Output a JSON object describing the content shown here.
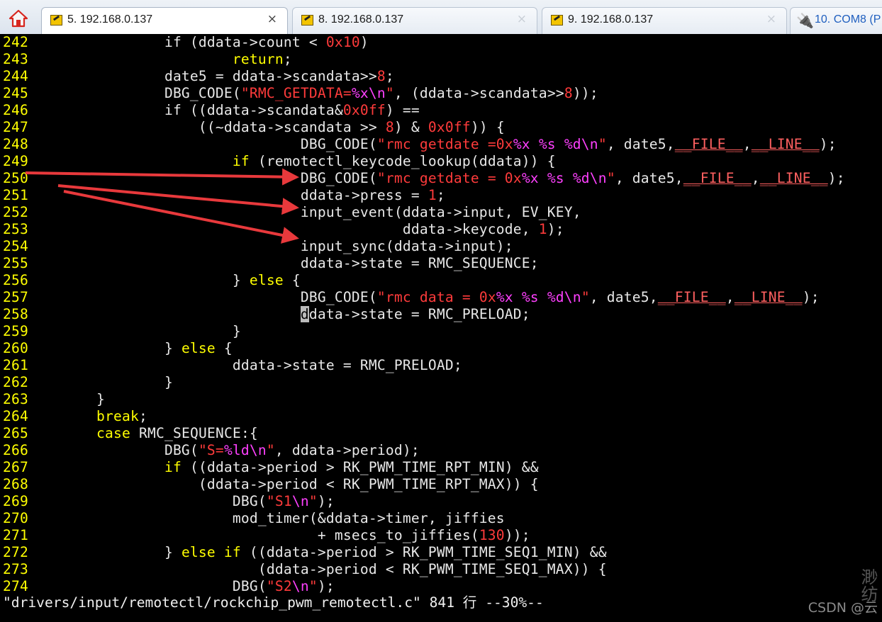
{
  "tabs": [
    {
      "label": "5. 192.168.0.137",
      "active": true,
      "close": "×"
    },
    {
      "label": "8. 192.168.0.137",
      "active": false,
      "close": "×"
    },
    {
      "label": "9. 192.168.0.137",
      "active": false,
      "close": "×"
    },
    {
      "label": "10. COM8  (P",
      "active": false
    }
  ],
  "code_lines": [
    {
      "num": "242",
      "segs": [
        [
          "t",
          "                if (ddata->count < "
        ],
        [
          "n",
          "0x10"
        ],
        [
          "t",
          ")"
        ]
      ]
    },
    {
      "num": "243",
      "segs": [
        [
          "t",
          "                        "
        ],
        [
          "k",
          "return"
        ],
        [
          "t",
          ";"
        ]
      ]
    },
    {
      "num": "244",
      "segs": [
        [
          "t",
          "                date5 = ddata->scandata>>"
        ],
        [
          "n",
          "8"
        ],
        [
          "t",
          ";"
        ]
      ]
    },
    {
      "num": "245",
      "segs": [
        [
          "t",
          "                DBG_CODE("
        ],
        [
          "s",
          "\"RMC_GETDATA="
        ],
        [
          "f",
          "%x\\n"
        ],
        [
          "s",
          "\""
        ],
        [
          "t",
          ", (ddata->scandata>>"
        ],
        [
          "n",
          "8"
        ],
        [
          "t",
          "));"
        ]
      ]
    },
    {
      "num": "246",
      "segs": [
        [
          "t",
          "                if ((ddata->scandata&"
        ],
        [
          "n",
          "0x0ff"
        ],
        [
          "t",
          ") =="
        ]
      ]
    },
    {
      "num": "247",
      "segs": [
        [
          "t",
          "                    ((~ddata->scandata >> "
        ],
        [
          "n",
          "8"
        ],
        [
          "t",
          ") & "
        ],
        [
          "n",
          "0x0ff"
        ],
        [
          "t",
          ")) {"
        ]
      ]
    },
    {
      "num": "248",
      "segs": [
        [
          "t",
          "                                DBG_CODE("
        ],
        [
          "s",
          "\"rmc getdate =0x"
        ],
        [
          "f",
          "%x"
        ],
        [
          "s",
          " "
        ],
        [
          "f",
          "%s"
        ],
        [
          "s",
          " "
        ],
        [
          "f",
          "%d\\n"
        ],
        [
          "s",
          "\""
        ],
        [
          "t",
          ", date5,"
        ],
        [
          "m",
          "__FILE__"
        ],
        [
          "t",
          ","
        ],
        [
          "m",
          "__LINE__"
        ],
        [
          "t",
          ");"
        ]
      ]
    },
    {
      "num": "249",
      "segs": [
        [
          "t",
          "                        "
        ],
        [
          "k",
          "if"
        ],
        [
          "t",
          " (remotectl_keycode_lookup(ddata)) {"
        ]
      ]
    },
    {
      "num": "250",
      "segs": [
        [
          "t",
          "                                DBG_CODE("
        ],
        [
          "s",
          "\"rmc getdate = 0x"
        ],
        [
          "f",
          "%x"
        ],
        [
          "s",
          " "
        ],
        [
          "f",
          "%s"
        ],
        [
          "s",
          " "
        ],
        [
          "f",
          "%d\\n"
        ],
        [
          "s",
          "\""
        ],
        [
          "t",
          ", date5,"
        ],
        [
          "m",
          "__FILE__"
        ],
        [
          "t",
          ","
        ],
        [
          "m",
          "__LINE__"
        ],
        [
          "t",
          ");"
        ]
      ]
    },
    {
      "num": "251",
      "segs": [
        [
          "t",
          "                                ddata->press = "
        ],
        [
          "n",
          "1"
        ],
        [
          "t",
          ";"
        ]
      ]
    },
    {
      "num": "252",
      "segs": [
        [
          "t",
          "                                input_event(ddata->input, EV_KEY,"
        ]
      ]
    },
    {
      "num": "253",
      "segs": [
        [
          "t",
          "                                            ddata->keycode, "
        ],
        [
          "n",
          "1"
        ],
        [
          "t",
          ");"
        ]
      ]
    },
    {
      "num": "254",
      "segs": [
        [
          "t",
          "                                input_sync(ddata->input);"
        ]
      ]
    },
    {
      "num": "255",
      "segs": [
        [
          "t",
          "                                ddata->state = RMC_SEQUENCE;"
        ]
      ]
    },
    {
      "num": "256",
      "segs": [
        [
          "t",
          "                        } "
        ],
        [
          "k",
          "else"
        ],
        [
          "t",
          " {"
        ]
      ]
    },
    {
      "num": "257",
      "segs": [
        [
          "t",
          "                                DBG_CODE("
        ],
        [
          "s",
          "\"rmc data = 0x"
        ],
        [
          "f",
          "%x"
        ],
        [
          "s",
          " "
        ],
        [
          "f",
          "%s"
        ],
        [
          "s",
          " "
        ],
        [
          "f",
          "%d\\n"
        ],
        [
          "s",
          "\""
        ],
        [
          "t",
          ", date5,"
        ],
        [
          "m",
          "__FILE__"
        ],
        [
          "t",
          ","
        ],
        [
          "m",
          "__LINE__"
        ],
        [
          "t",
          ");"
        ]
      ]
    },
    {
      "num": "258",
      "segs": [
        [
          "t",
          "                                "
        ],
        [
          "c",
          "d"
        ],
        [
          "t",
          "data->state = RMC_PRELOAD;"
        ]
      ]
    },
    {
      "num": "259",
      "segs": [
        [
          "t",
          "                        }"
        ]
      ]
    },
    {
      "num": "260",
      "segs": [
        [
          "t",
          "                } "
        ],
        [
          "k",
          "else"
        ],
        [
          "t",
          " {"
        ]
      ]
    },
    {
      "num": "261",
      "segs": [
        [
          "t",
          "                        ddata->state = RMC_PRELOAD;"
        ]
      ]
    },
    {
      "num": "262",
      "segs": [
        [
          "t",
          "                }"
        ]
      ]
    },
    {
      "num": "263",
      "segs": [
        [
          "t",
          "        }"
        ]
      ]
    },
    {
      "num": "264",
      "segs": [
        [
          "t",
          "        "
        ],
        [
          "k",
          "break"
        ],
        [
          "t",
          ";"
        ]
      ]
    },
    {
      "num": "265",
      "segs": [
        [
          "t",
          "        "
        ],
        [
          "k",
          "case"
        ],
        [
          "t",
          " RMC_SEQUENCE:{"
        ]
      ]
    },
    {
      "num": "266",
      "segs": [
        [
          "t",
          "                DBG("
        ],
        [
          "s",
          "\"S="
        ],
        [
          "f",
          "%ld\\n"
        ],
        [
          "s",
          "\""
        ],
        [
          "t",
          ", ddata->period);"
        ]
      ]
    },
    {
      "num": "267",
      "segs": [
        [
          "t",
          "                "
        ],
        [
          "k",
          "if"
        ],
        [
          "t",
          " ((ddata->period > RK_PWM_TIME_RPT_MIN) &&"
        ]
      ]
    },
    {
      "num": "268",
      "segs": [
        [
          "t",
          "                    (ddata->period < RK_PWM_TIME_RPT_MAX)) {"
        ]
      ]
    },
    {
      "num": "269",
      "segs": [
        [
          "t",
          "                        DBG("
        ],
        [
          "s",
          "\"S1"
        ],
        [
          "f",
          "\\n"
        ],
        [
          "s",
          "\""
        ],
        [
          "t",
          ");"
        ]
      ]
    },
    {
      "num": "270",
      "segs": [
        [
          "t",
          "                        mod_timer(&ddata->timer, jiffies"
        ]
      ]
    },
    {
      "num": "271",
      "segs": [
        [
          "t",
          "                                  + msecs_to_jiffies("
        ],
        [
          "n",
          "130"
        ],
        [
          "t",
          "));"
        ]
      ]
    },
    {
      "num": "272",
      "segs": [
        [
          "t",
          "                } "
        ],
        [
          "k",
          "else if"
        ],
        [
          "t",
          " ((ddata->period > RK_PWM_TIME_SEQ1_MIN) &&"
        ]
      ]
    },
    {
      "num": "273",
      "segs": [
        [
          "t",
          "                           (ddata->period < RK_PWM_TIME_SEQ1_MAX)) {"
        ]
      ]
    },
    {
      "num": "274",
      "segs": [
        [
          "t",
          "                        DBG("
        ],
        [
          "s",
          "\"S2"
        ],
        [
          "f",
          "\\n"
        ],
        [
          "s",
          "\""
        ],
        [
          "t",
          ");"
        ]
      ]
    }
  ],
  "status_line": "\"drivers/input/remotectl/rockchip_pwm_remotectl.c\" 841 行 --30%--",
  "watermark": "CSDN @云",
  "watermark_edge": "渺纺",
  "colors": {
    "line_number": "#ffff00",
    "keyword": "#ffff00",
    "string": "#ff3b3b",
    "format_spec": "#ff40ff",
    "number": "#ff3b3b",
    "arrow": "#e8393c",
    "background": "#000000"
  },
  "icons": {
    "home": "home-icon",
    "tab": "putty-key-icon",
    "serial": "serial-plug-icon"
  }
}
